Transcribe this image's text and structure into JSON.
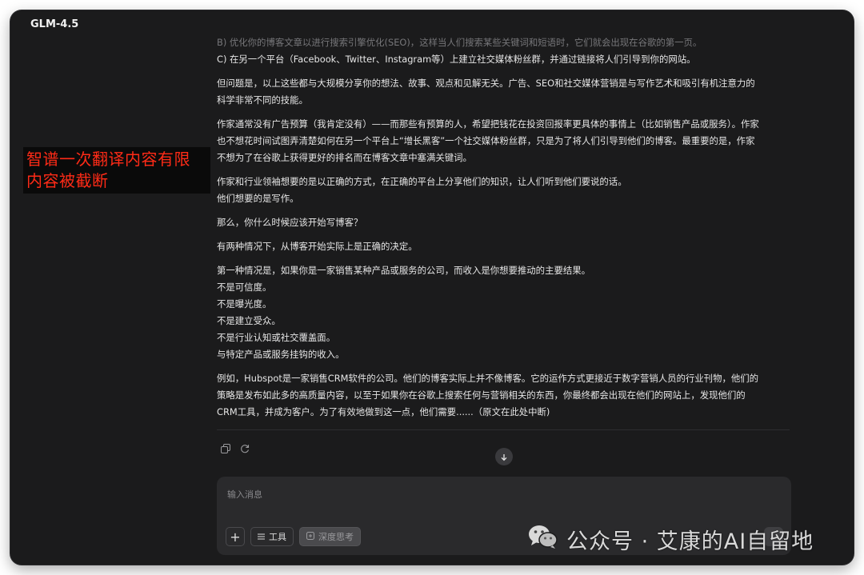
{
  "app": {
    "title": "GLM-4.5"
  },
  "overlay": {
    "lines": [
      "智谱一次翻译内容有限",
      "内容被截断"
    ]
  },
  "message": {
    "paragraphs": [
      {
        "lines": [
          "B) 优化你的博客文章以进行搜索引擎优化(SEO)，这样当人们搜索某些关键词和短语时，它们就会出现在谷歌的第一页。",
          "C) 在另一个平台（Facebook、Twitter、Instagram等）上建立社交媒体粉丝群，并通过链接将人们引导到你的网站。"
        ]
      },
      {
        "lines": [
          "但问题是，以上这些都与大规模分享你的想法、故事、观点和见解无关。广告、SEO和社交媒体营销是与写作艺术和吸引有机注意力的",
          "科学非常不同的技能。"
        ]
      },
      {
        "lines": [
          "作家通常没有广告预算（我肯定没有）——而那些有预算的人，希望把钱花在投资回报率更具体的事情上（比如销售产品或服务）。作家",
          "也不想花时间试图弄清楚如何在另一个平台上“增长黑客”一个社交媒体粉丝群，只是为了将人们引导到他们的博客。最重要的是，作家",
          "不想为了在谷歌上获得更好的排名而在博客文章中塞满关键词。"
        ]
      },
      {
        "lines": [
          "作家和行业领袖想要的是以正确的方式，在正确的平台上分享他们的知识，让人们听到他们要说的话。",
          "他们想要的是写作。"
        ]
      },
      {
        "lines": [
          "那么，你什么时候应该开始写博客？"
        ]
      },
      {
        "lines": [
          "有两种情况下，从博客开始实际上是正确的决定。"
        ]
      },
      {
        "lines": [
          "第一种情况是，如果你是一家销售某种产品或服务的公司，而收入是你想要推动的主要结果。",
          "不是可信度。",
          "不是曝光度。",
          "不是建立受众。",
          "不是行业认知或社交覆盖面。",
          "与特定产品或服务挂钩的收入。"
        ]
      },
      {
        "lines": [
          "例如，Hubspot是一家销售CRM软件的公司。他们的博客实际上并不像博客。它的运作方式更接近于数字营销人员的行业刊物，他们的",
          "策略是发布如此多的高质量内容，以至于如果你在谷歌上搜索任何与营销相关的东西，你最终都会出现在他们的网站上，发现他们的",
          "CRM工具，并成为客户。为了有效地做到这一点，他们需要......（原文在此处中断)"
        ]
      }
    ]
  },
  "actions": {
    "copy_icon": "copy-icon",
    "regenerate_icon": "refresh-icon",
    "scroll_icon": "arrow-down-icon"
  },
  "composer": {
    "placeholder": "输入消息",
    "plus_label": "+",
    "tools_label": "工具",
    "deep_think_label": "深度思考"
  },
  "watermark": {
    "text": "公众号 · 艾康的AI自留地"
  },
  "colors": {
    "window_bg": "#1b1b1c",
    "banner_text": "#ff2b17",
    "composer_bg": "#2a2a2c"
  }
}
